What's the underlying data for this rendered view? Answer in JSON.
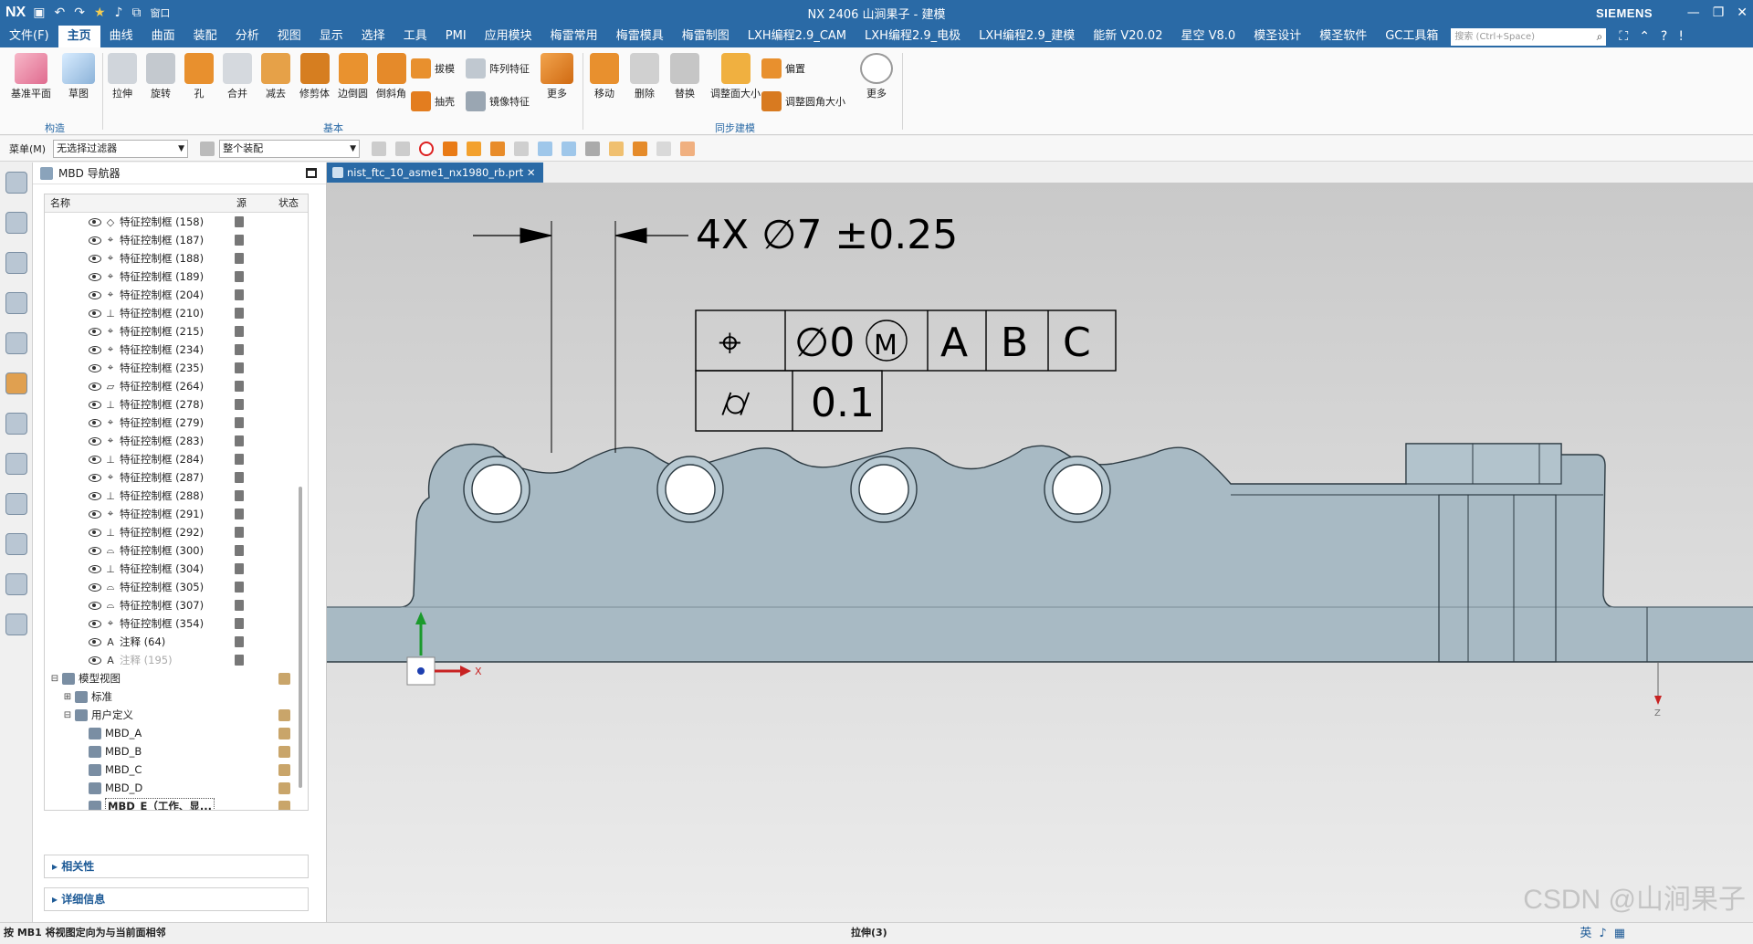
{
  "app": {
    "logo": "NX",
    "title": "NX 2406 山涧果子 - 建模",
    "brand": "SIEMENS",
    "window_label": "窗口"
  },
  "menus": [
    "文件(F)",
    "主页",
    "曲线",
    "曲面",
    "装配",
    "分析",
    "视图",
    "显示",
    "选择",
    "工具",
    "PMI",
    "应用模块",
    "梅雷常用",
    "梅雷模具",
    "梅雷制图",
    "LXH编程2.9_CAM",
    "LXH编程2.9_电极",
    "LXH编程2.9_建模",
    "能新 V20.02",
    "星空 V8.0",
    "模圣设计",
    "模圣软件",
    "GC工具箱"
  ],
  "active_menu_index": 1,
  "search_placeholder": "搜索 (Ctrl+Space)",
  "ribbon": {
    "construct": {
      "label": "构造",
      "buttons": [
        "基准平面",
        "草图"
      ]
    },
    "basic": {
      "label": "基本",
      "buttons": [
        "拉伸",
        "旋转",
        "孔",
        "合并",
        "减去",
        "修剪体",
        "边倒圆",
        "倒斜角"
      ],
      "small": [
        "拔模",
        "抽壳",
        "阵列特征",
        "镜像特征"
      ],
      "more": "更多"
    },
    "sync": {
      "label": "同步建模",
      "buttons": [
        "移动",
        "删除",
        "替换",
        "调整面大小"
      ],
      "small": [
        "偏置",
        "调整圆角大小"
      ],
      "more": "更多"
    }
  },
  "toolbar": {
    "menu_label": "菜单(M)",
    "filter": "无选择过滤器",
    "scope": "整个装配"
  },
  "navigator": {
    "title": "MBD 导航器",
    "col_name": "名称",
    "col_source": "源",
    "col_status": "状态",
    "feature_rows": [
      {
        "sym": "◇",
        "label": "特征控制框 (158)"
      },
      {
        "sym": "⌖",
        "label": "特征控制框 (187)"
      },
      {
        "sym": "⌖",
        "label": "特征控制框 (188)"
      },
      {
        "sym": "⌖",
        "label": "特征控制框 (189)"
      },
      {
        "sym": "⌖",
        "label": "特征控制框 (204)"
      },
      {
        "sym": "⊥",
        "label": "特征控制框 (210)"
      },
      {
        "sym": "⌖",
        "label": "特征控制框 (215)"
      },
      {
        "sym": "⌖",
        "label": "特征控制框 (234)"
      },
      {
        "sym": "⌖",
        "label": "特征控制框 (235)"
      },
      {
        "sym": "▱",
        "label": "特征控制框 (264)"
      },
      {
        "sym": "⊥",
        "label": "特征控制框 (278)"
      },
      {
        "sym": "⌖",
        "label": "特征控制框 (279)"
      },
      {
        "sym": "⌖",
        "label": "特征控制框 (283)"
      },
      {
        "sym": "⊥",
        "label": "特征控制框 (284)"
      },
      {
        "sym": "⌖",
        "label": "特征控制框 (287)"
      },
      {
        "sym": "⊥",
        "label": "特征控制框 (288)"
      },
      {
        "sym": "⌖",
        "label": "特征控制框 (291)"
      },
      {
        "sym": "⊥",
        "label": "特征控制框 (292)"
      },
      {
        "sym": "⌓",
        "label": "特征控制框 (300)"
      },
      {
        "sym": "⊥",
        "label": "特征控制框 (304)"
      },
      {
        "sym": "⌓",
        "label": "特征控制框 (305)"
      },
      {
        "sym": "⌓",
        "label": "特征控制框 (307)"
      },
      {
        "sym": "⌖",
        "label": "特征控制框 (354)"
      },
      {
        "sym": "A",
        "label": "注释 (64)"
      }
    ],
    "hidden_note": "注释 (195)",
    "model_views": "模型视图",
    "standard": "标准",
    "user_defined": "用户定义",
    "views": [
      "MBD_A",
      "MBD_B",
      "MBD_C",
      "MBD_D"
    ],
    "current_view": "MBD_E（工作、显...",
    "sections": [
      "相关性",
      "详细信息"
    ]
  },
  "doc_tab": "nist_ftc_10_asme1_nx1980_rb.prt",
  "annotation": {
    "dimension": "4X ∅7 ±0.25",
    "fcf_row1": [
      "⌖",
      "∅0",
      "M",
      "A",
      "B",
      "C"
    ],
    "fcf_row2": [
      "⌭",
      "0.1"
    ]
  },
  "triad": {
    "x": "X",
    "z": "Z"
  },
  "status": {
    "left": "按 MB1 将视图定向为与当前面相邻",
    "center": "拉伸(3)",
    "watermark": "CSDN @山涧果子",
    "ime": "英"
  }
}
